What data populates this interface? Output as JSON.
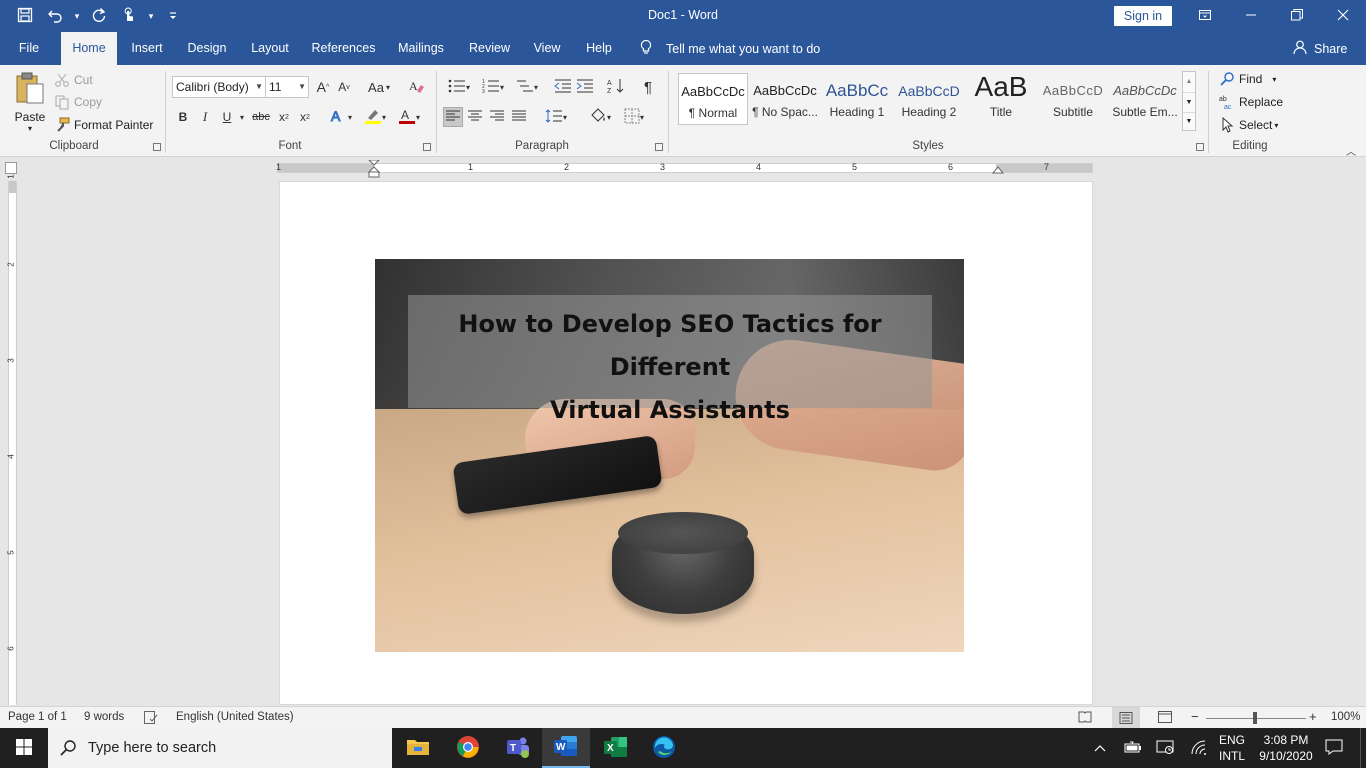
{
  "window": {
    "doc_title": "Doc1  -  Word",
    "signin_label": "Sign in"
  },
  "tabs": [
    {
      "label": "File"
    },
    {
      "label": "Home"
    },
    {
      "label": "Insert"
    },
    {
      "label": "Design"
    },
    {
      "label": "Layout"
    },
    {
      "label": "References"
    },
    {
      "label": "Mailings"
    },
    {
      "label": "Review"
    },
    {
      "label": "View"
    },
    {
      "label": "Help"
    }
  ],
  "tellme": "Tell me what you want to do",
  "share": "Share",
  "clipboard": {
    "paste": "Paste",
    "cut": "Cut",
    "copy": "Copy",
    "format_painter": "Format Painter",
    "group": "Clipboard"
  },
  "font": {
    "name": "Calibri (Body)",
    "size": "11",
    "grow": "A",
    "case": "Aa",
    "bold": "B",
    "italic": "I",
    "underline": "U",
    "strike": "abc",
    "subscript": "x",
    "superscript": "x",
    "group": "Font"
  },
  "paragraph": {
    "group": "Paragraph"
  },
  "styles": {
    "group": "Styles",
    "items": [
      {
        "sample": "AaBbCcDc",
        "name": "¶ Normal"
      },
      {
        "sample": "AaBbCcDc",
        "name": "¶ No Spac..."
      },
      {
        "sample": "AaBbCc",
        "name": "Heading 1"
      },
      {
        "sample": "AaBbCcD",
        "name": "Heading 2"
      },
      {
        "sample": "AaB",
        "name": "Title"
      },
      {
        "sample": "AaBbCcD",
        "name": "Subtitle"
      },
      {
        "sample": "AaBbCcDc",
        "name": "Subtle Em..."
      }
    ]
  },
  "editing": {
    "find": "Find",
    "replace": "Replace",
    "select": "Select",
    "group": "Editing"
  },
  "ruler": {
    "h_numbers": [
      "1",
      "1",
      "2",
      "3",
      "4",
      "5",
      "6",
      "7"
    ],
    "v_numbers": [
      "1",
      "2",
      "3",
      "4",
      "5",
      "6"
    ]
  },
  "document": {
    "headline_line1": "How to Develop SEO Tactics for Different",
    "headline_line2": "Virtual Assistants"
  },
  "status": {
    "page": "Page 1 of 1",
    "words": "9 words",
    "language": "English (United States)",
    "zoom": "100%",
    "zoom_level": 1.0
  },
  "taskbar": {
    "search_placeholder": "Type here to search",
    "lang1": "ENG",
    "lang2": "INTL",
    "time": "3:08 PM",
    "date": "9/10/2020"
  },
  "colors": {
    "accent": "#2b579a",
    "taskbar": "#202020"
  }
}
